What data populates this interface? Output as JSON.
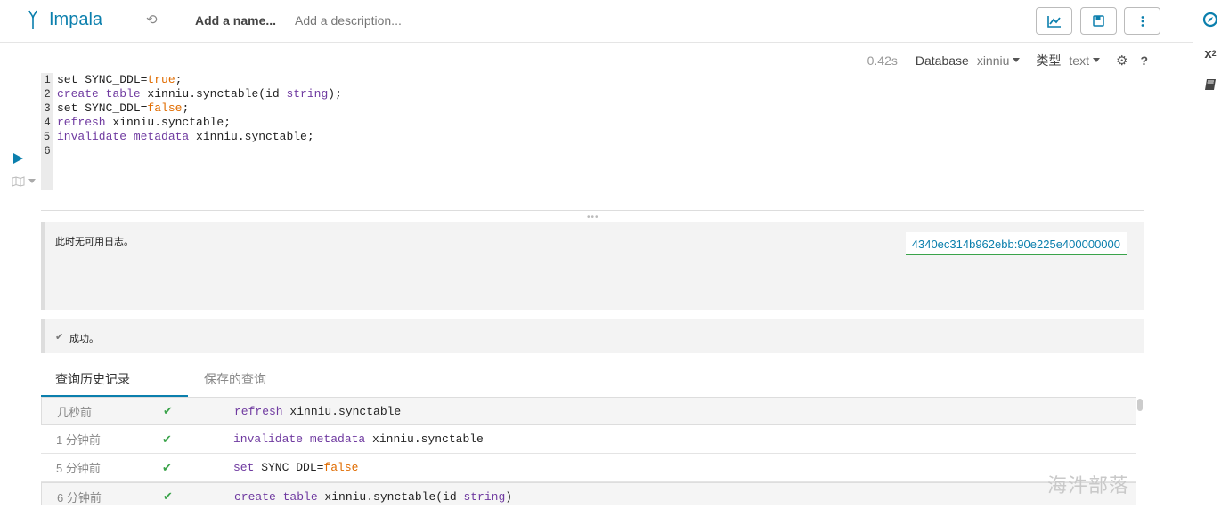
{
  "header": {
    "app_name": "Impala",
    "name_placeholder": "Add a name...",
    "description_placeholder": "Add a description...",
    "buttons": [
      {
        "name": "chart-button",
        "icon": "line-chart-icon"
      },
      {
        "name": "save-button",
        "icon": "floppy-disk-icon"
      },
      {
        "name": "more-button",
        "icon": "vertical-ellipsis-icon"
      }
    ]
  },
  "right_rail": {
    "icons": [
      "compass-icon",
      "superscript-x2-icon",
      "book-icon"
    ]
  },
  "execution_meta": {
    "duration": "0.42s",
    "database_label": "Database",
    "database_value": "xinniu",
    "type_label": "类型",
    "type_value": "text"
  },
  "editor": {
    "lines": [
      {
        "num": "1",
        "tokens": [
          {
            "t": "set SYNC_DDL=",
            "c": ""
          },
          {
            "t": "true",
            "c": "bool"
          },
          {
            "t": ";",
            "c": ""
          }
        ]
      },
      {
        "num": "2",
        "tokens": [
          {
            "t": "create table",
            "c": "kw"
          },
          {
            "t": " xinniu.synctable(id ",
            "c": ""
          },
          {
            "t": "string",
            "c": "kw"
          },
          {
            "t": ");",
            "c": ""
          }
        ]
      },
      {
        "num": "3",
        "tokens": [
          {
            "t": "set SYNC_DDL=",
            "c": ""
          },
          {
            "t": "false",
            "c": "bool"
          },
          {
            "t": ";",
            "c": ""
          }
        ]
      },
      {
        "num": "4",
        "tokens": [
          {
            "t": "refresh",
            "c": "kw"
          },
          {
            "t": " xinniu.synctable;",
            "c": ""
          }
        ]
      },
      {
        "num": "5",
        "tokens": [
          {
            "t": "invalidate metadata",
            "c": "kw"
          },
          {
            "t": " xinniu.synctable;",
            "c": ""
          }
        ]
      },
      {
        "num": "6",
        "tokens": []
      }
    ],
    "active_line": 5
  },
  "log": {
    "message": "此时无可用日志。",
    "query_id": "4340ec314b962ebb:90e225e400000000"
  },
  "status": {
    "message": "成功。"
  },
  "tabs": [
    {
      "label": "查询历史记录",
      "active": true
    },
    {
      "label": "保存的查询",
      "active": false
    }
  ],
  "history": [
    {
      "when": "几秒前",
      "status": "success",
      "tokens": [
        {
          "t": "refresh",
          "c": "kw"
        },
        {
          "t": " xinniu.synctable",
          "c": ""
        }
      ]
    },
    {
      "when": "1 分钟前",
      "status": "success",
      "tokens": [
        {
          "t": "invalidate metadata",
          "c": "kw"
        },
        {
          "t": " xinniu.synctable",
          "c": ""
        }
      ]
    },
    {
      "when": "5 分钟前",
      "status": "success",
      "tokens": [
        {
          "t": "set",
          "c": "kw"
        },
        {
          "t": " SYNC_DDL=",
          "c": ""
        },
        {
          "t": "false",
          "c": "bool"
        }
      ]
    },
    {
      "when": "6 分钟前",
      "status": "success",
      "tokens": [
        {
          "t": "create table",
          "c": "kw"
        },
        {
          "t": " xinniu.synctable(id ",
          "c": ""
        },
        {
          "t": "string",
          "c": "kw"
        },
        {
          "t": ")",
          "c": ""
        }
      ]
    }
  ],
  "watermark": "海汼部落",
  "colors": {
    "accent": "#0b7fad",
    "success": "#3aa34a",
    "keyword": "#6f3aa0",
    "literal": "#e06c00"
  }
}
